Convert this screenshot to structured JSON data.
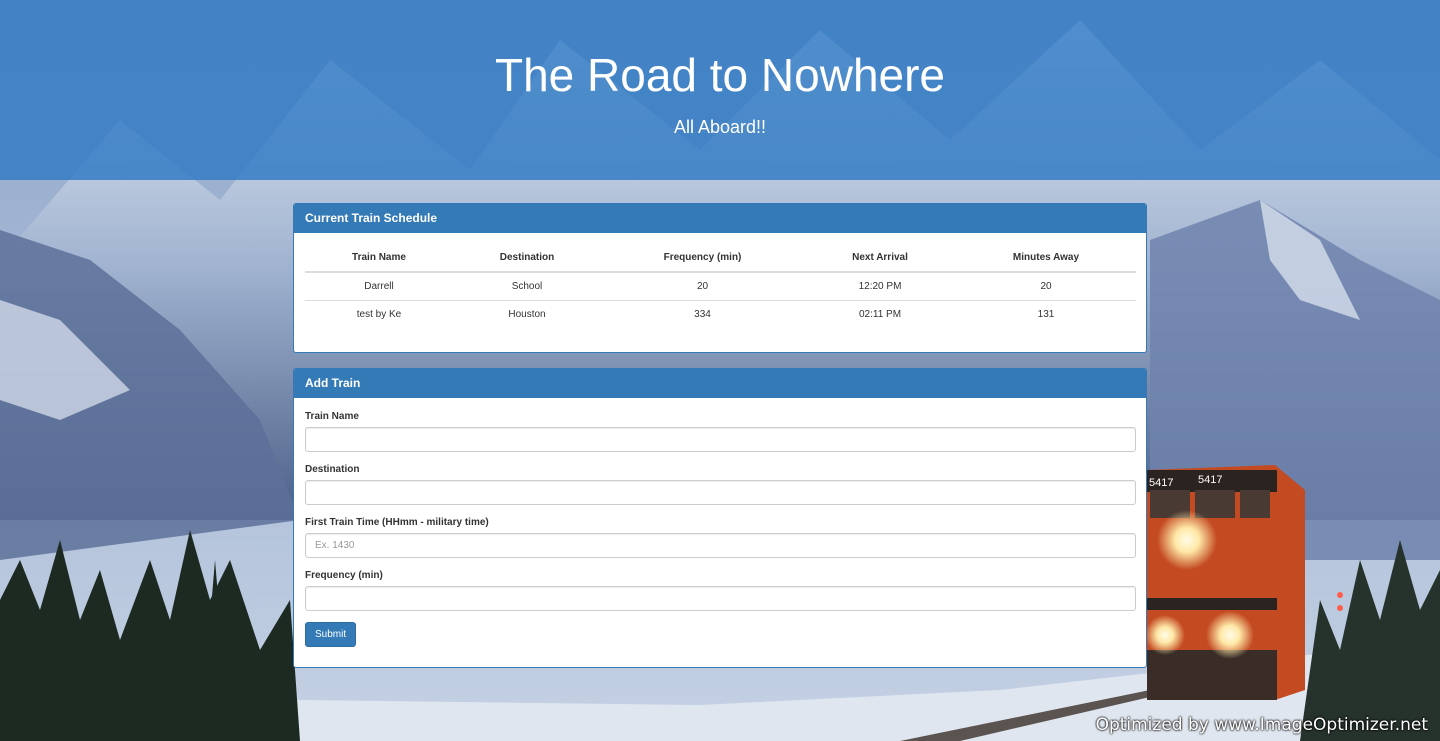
{
  "header": {
    "title": "The Road to Nowhere",
    "subtitle": "All Aboard!!"
  },
  "schedule": {
    "heading": "Current Train Schedule",
    "columns": [
      "Train Name",
      "Destination",
      "Frequency (min)",
      "Next Arrival",
      "Minutes Away"
    ],
    "rows": [
      [
        "Darrell",
        "School",
        "20",
        "12:20 PM",
        "20"
      ],
      [
        "test by Ke",
        "Houston",
        "334",
        "02:11 PM",
        "131"
      ]
    ]
  },
  "add_train": {
    "heading": "Add Train",
    "train_name": {
      "label": "Train Name",
      "value": "",
      "placeholder": ""
    },
    "destination": {
      "label": "Destination",
      "value": "",
      "placeholder": ""
    },
    "first_time": {
      "label": "First Train Time (HHmm - military time)",
      "value": "",
      "placeholder": "Ex. 1430"
    },
    "frequency": {
      "label": "Frequency (min)",
      "value": "",
      "placeholder": ""
    },
    "submit_label": "Submit"
  },
  "locomotive": {
    "number_left": "5417",
    "number_right": "5417"
  },
  "watermark": "Optimized by www.ImageOptimizer.net",
  "colors": {
    "primary": "#337ab7",
    "header_overlay": "#357cc4"
  }
}
